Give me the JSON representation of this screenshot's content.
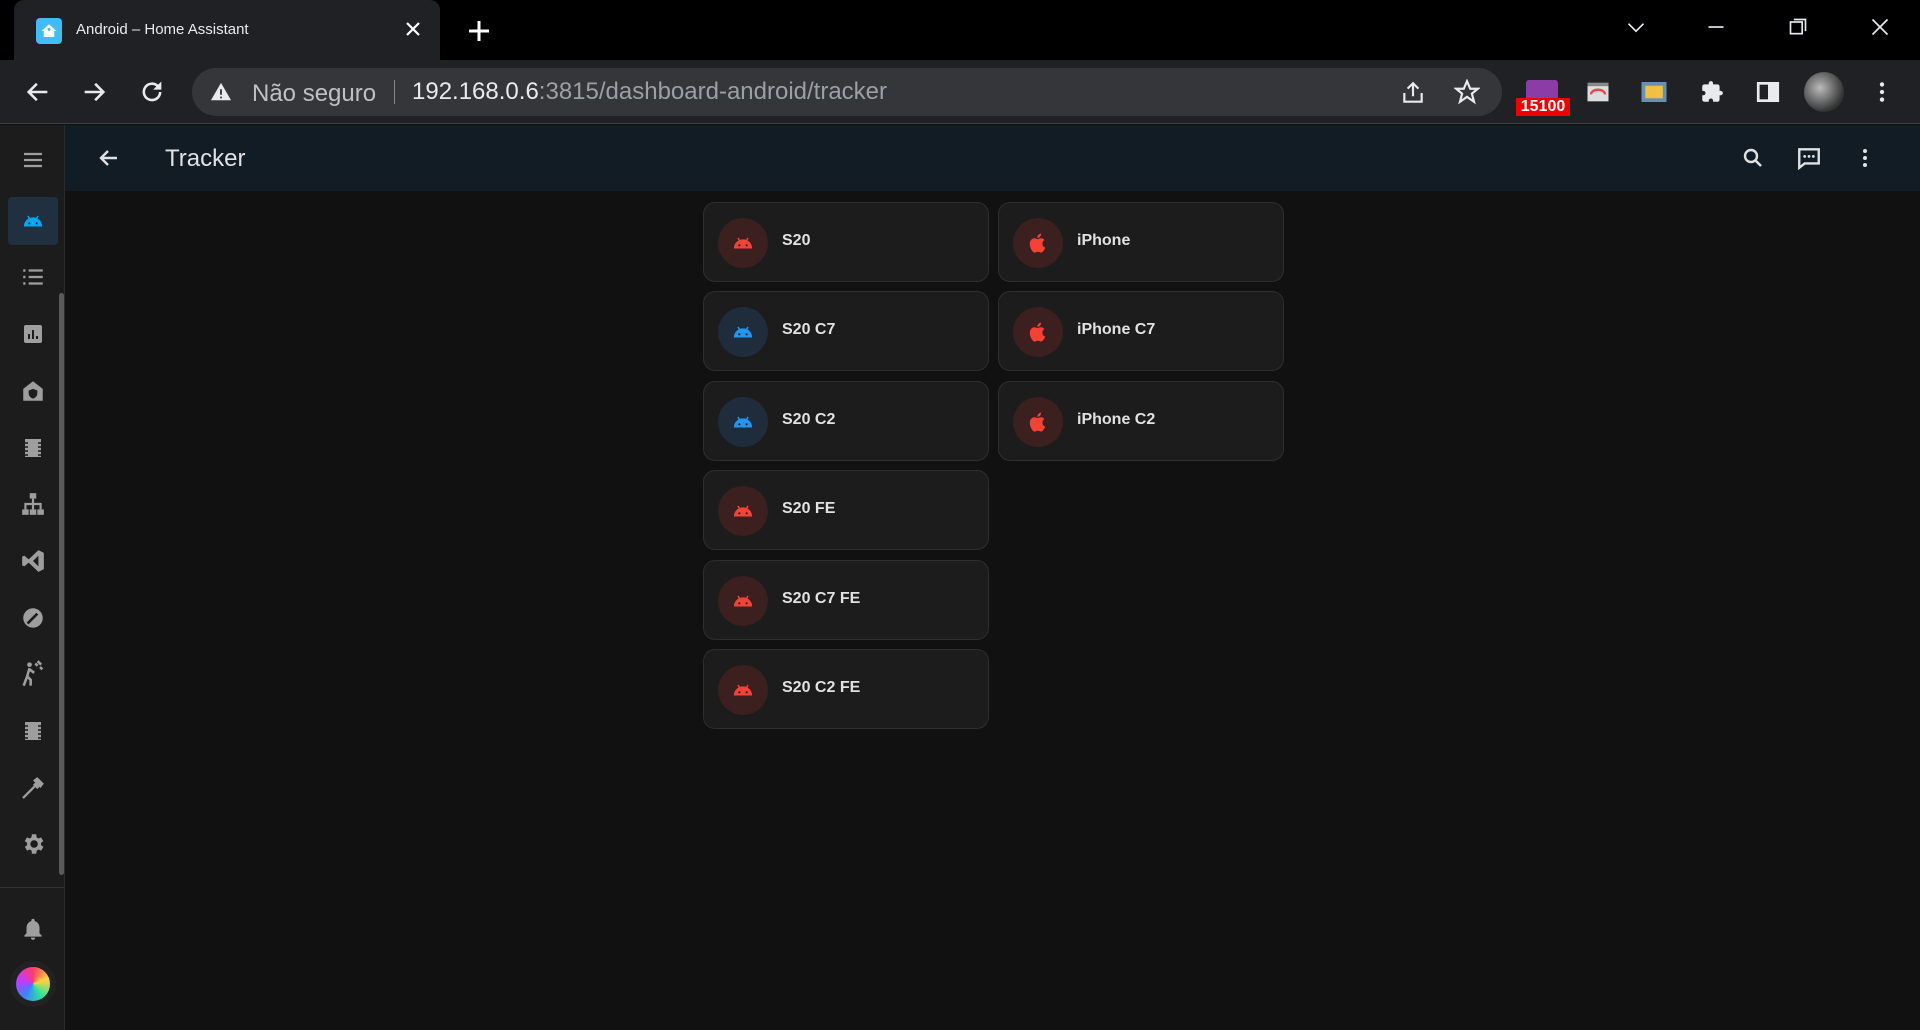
{
  "browser": {
    "tab_title": "Android – Home Assistant",
    "security_label": "Não seguro",
    "url_host": "192.168.0.6",
    "url_rest": ":3815/dashboard-android/tracker",
    "extension_badge": "15100"
  },
  "header": {
    "title": "Tracker"
  },
  "sidebar": {
    "items": [
      {
        "icon": "android-icon",
        "active": true
      },
      {
        "icon": "format-list-icon"
      },
      {
        "icon": "chart-box-icon"
      },
      {
        "icon": "home-shield-icon"
      },
      {
        "icon": "film-strip-icon"
      },
      {
        "icon": "sitemap-icon"
      },
      {
        "icon": "vscode-icon"
      },
      {
        "icon": "speedometer-icon"
      },
      {
        "icon": "motion-walk-icon"
      },
      {
        "icon": "film-strip-icon"
      },
      {
        "icon": "hammer-icon"
      },
      {
        "icon": "cog-icon"
      }
    ]
  },
  "cards": [
    {
      "label": "S20",
      "icon": "android-icon",
      "color": "#f44336"
    },
    {
      "label": "iPhone",
      "icon": "apple-icon",
      "color": "#f44336"
    },
    {
      "label": "S20 C7",
      "icon": "android-icon",
      "color": "#2196f3"
    },
    {
      "label": "iPhone C7",
      "icon": "apple-icon",
      "color": "#f44336"
    },
    {
      "label": "S20 C2",
      "icon": "android-icon",
      "color": "#2196f3"
    },
    {
      "label": "iPhone C2",
      "icon": "apple-icon",
      "color": "#f44336"
    },
    {
      "label": "S20 FE",
      "icon": "android-icon",
      "color": "#f44336"
    },
    {
      "label": "S20 C7 FE",
      "icon": "android-icon",
      "color": "#f44336"
    },
    {
      "label": "S20 C2 FE",
      "icon": "android-icon",
      "color": "#f44336"
    }
  ]
}
